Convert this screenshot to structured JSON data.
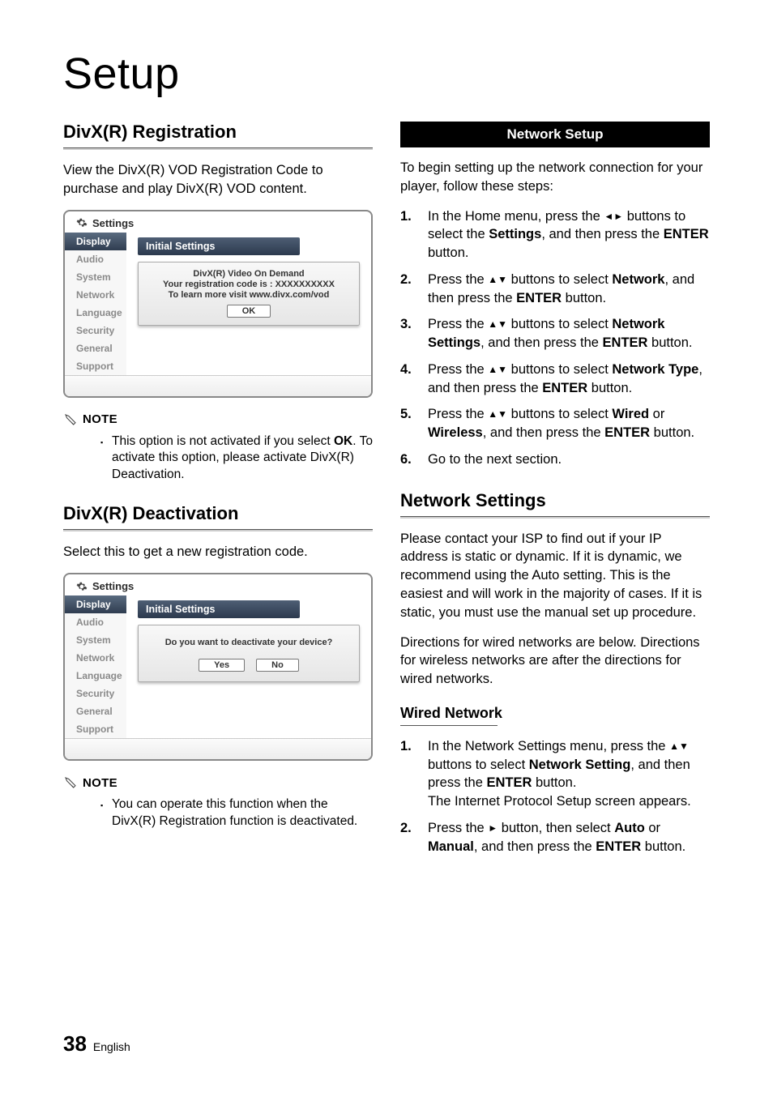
{
  "page": {
    "title": "Setup",
    "number": "38",
    "lang": "English"
  },
  "left": {
    "divx_reg": {
      "heading": "DivX(R) Registration",
      "intro": "View the DivX(R) VOD Registration Code to purchase and play DivX(R) VOD content.",
      "note_label": "NOTE",
      "note_items_pre": "This option is not activated if you select ",
      "note_items_bold": "OK",
      "note_items_post": ". To activate this option, please activate DivX(R) Deactivation."
    },
    "divx_deact": {
      "heading": "DivX(R) Deactivation",
      "intro": "Select this to get a new registration code.",
      "note_label": "NOTE",
      "note_text": "You can operate this function when the DivX(R) Registration function is deactivated."
    },
    "osd": {
      "settings_label": "Settings",
      "menu": [
        "Display",
        "Audio",
        "System",
        "Network",
        "Language",
        "Security",
        "General",
        "Support"
      ],
      "initial_settings": "Initial Settings",
      "reg_dialog": {
        "l1": "DivX(R) Video On Demand",
        "l2": "Your registration code is : XXXXXXXXXX",
        "l3": "To learn more visit www.divx.com/vod",
        "ok": "OK"
      },
      "deact_dialog": {
        "l1": "Do you want to deactivate your device?",
        "yes": "Yes",
        "no": "No"
      }
    }
  },
  "right": {
    "banner": "Network Setup",
    "intro": "To begin setting up the network connection for your player, follow these steps:",
    "steps": [
      {
        "n": "1.",
        "pre": "In the Home menu, press the ",
        "sym": "◄►",
        "mid": " buttons to select the ",
        "b1": "Settings",
        "mid2": ", and then press the ",
        "b2": "ENTER",
        "post": " button."
      },
      {
        "n": "2.",
        "pre": "Press the ",
        "sym": "▲▼",
        "mid": " buttons to select ",
        "b1": "Network",
        "mid2": ", and then press the ",
        "b2": "ENTER",
        "post": " button."
      },
      {
        "n": "3.",
        "pre": "Press the ",
        "sym": "▲▼",
        "mid": " buttons to select ",
        "b1": "Network Settings",
        "mid2": ", and then press the ",
        "b2": "ENTER",
        "post": " button."
      },
      {
        "n": "4.",
        "pre": "Press the ",
        "sym": "▲▼",
        "mid": " buttons to select ",
        "b1": "Network Type",
        "mid2": ", and then press the ",
        "b2": "ENTER",
        "post": " button."
      },
      {
        "n": "5.",
        "pre": "Press the ",
        "sym": "▲▼",
        "mid": " buttons to select ",
        "b1": "Wired",
        "or": " or ",
        "b1b": "Wireless",
        "mid2": ", and then press the ",
        "b2": "ENTER",
        "post": " button."
      },
      {
        "n": "6.",
        "plain": "Go to the next section."
      }
    ],
    "net_settings": {
      "heading": "Network Settings",
      "p1": "Please contact your ISP to find out if your IP address is static or dynamic. If it is dynamic, we recommend using the Auto setting. This is the easiest and will work in the majority of cases. If it is static, you must use the manual set up procedure.",
      "p2": "Directions for wired networks are below. Directions for wireless networks are after the directions for wired networks."
    },
    "wired": {
      "heading": "Wired Network",
      "steps": [
        {
          "n": "1.",
          "pre": "In the Network Settings menu, press the ",
          "sym": "▲▼",
          "mid": " buttons to select ",
          "b1": "Network Setting",
          "mid2": ", and then press the ",
          "b2": "ENTER",
          "post": " button.",
          "extra": "The Internet Protocol Setup screen appears."
        },
        {
          "n": "2.",
          "pre": "Press the ",
          "sym": "►",
          "mid": " button, then select ",
          "b1": "Auto",
          "or": " or ",
          "b1b": "Manual",
          "mid2": ", and then press the ",
          "b2": "ENTER",
          "post": " button."
        }
      ]
    }
  }
}
